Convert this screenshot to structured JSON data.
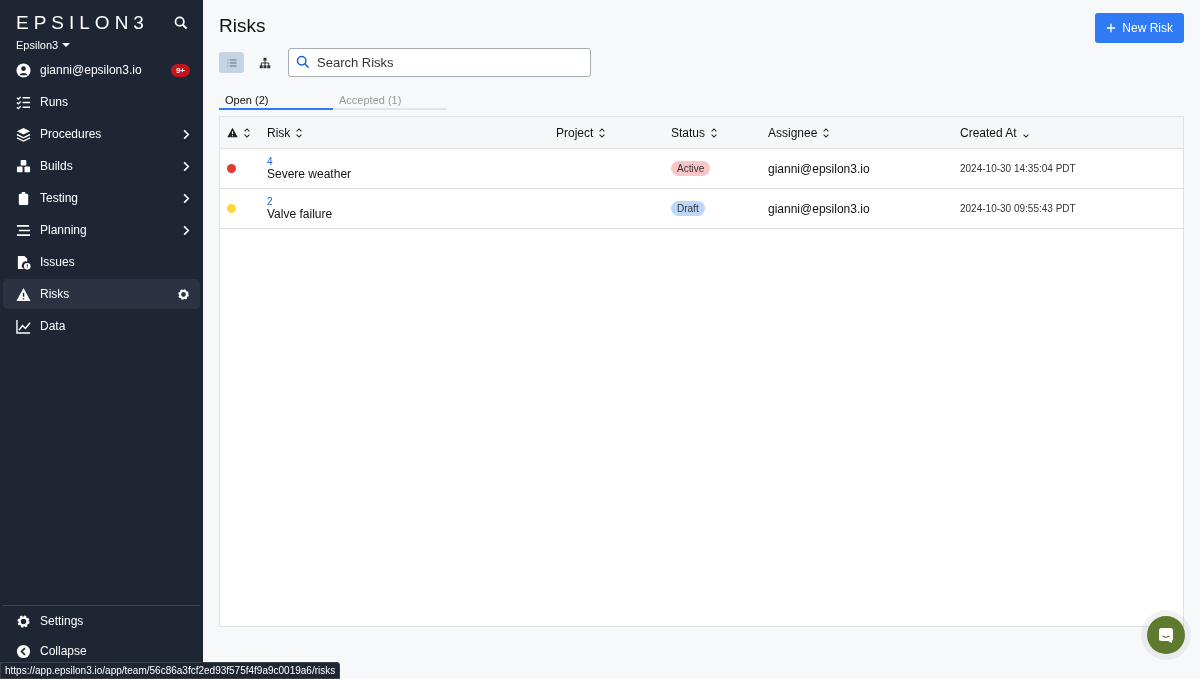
{
  "sidebar": {
    "logo": "EPSILON3",
    "workspace": "Epsilon3",
    "user": {
      "label": "gianni@epsilon3.io",
      "badge": "9+"
    },
    "items": [
      {
        "label": "Runs",
        "kind": "runs",
        "expandable": false,
        "selected": false
      },
      {
        "label": "Procedures",
        "kind": "layers",
        "expandable": true,
        "selected": false
      },
      {
        "label": "Builds",
        "kind": "cubes",
        "expandable": true,
        "selected": false
      },
      {
        "label": "Testing",
        "kind": "clipboard",
        "expandable": true,
        "selected": false
      },
      {
        "label": "Planning",
        "kind": "bars",
        "expandable": true,
        "selected": false
      },
      {
        "label": "Issues",
        "kind": "file",
        "expandable": false,
        "selected": false
      },
      {
        "label": "Risks",
        "kind": "warning",
        "expandable": false,
        "selected": true
      },
      {
        "label": "Data",
        "kind": "chart",
        "expandable": false,
        "selected": false
      }
    ],
    "footer": [
      {
        "label": "Settings",
        "kind": "gear"
      },
      {
        "label": "Collapse",
        "kind": "collapse"
      }
    ]
  },
  "page": {
    "title": "Risks",
    "new_button": "New Risk",
    "views": [
      {
        "kind": "list",
        "selected": true
      },
      {
        "kind": "tree",
        "selected": false
      }
    ],
    "search": {
      "placeholder": "Search Risks"
    },
    "tabs": [
      {
        "label": "Open (2)",
        "selected": true
      },
      {
        "label": "Accepted (1)",
        "selected": false
      }
    ]
  },
  "table": {
    "columns": [
      {
        "kind": "icon",
        "sorted": false
      },
      {
        "kind": "text",
        "label": "Risk",
        "sorted": false
      },
      {
        "kind": "text",
        "label": "Project",
        "sorted": false
      },
      {
        "kind": "text",
        "label": "Status",
        "sorted": false
      },
      {
        "kind": "text",
        "label": "Assignee",
        "sorted": false
      },
      {
        "kind": "text",
        "label": "Created At",
        "sorted": true
      }
    ],
    "rows": [
      {
        "color": "#e53935",
        "id": "4",
        "name": "Severe weather",
        "status": {
          "label": "Active",
          "color": "#f9c6c8"
        },
        "assignee": "gianni@epsilon3.io",
        "created": "2024-10-30 14:35:04 PDT"
      },
      {
        "color": "#fdd835",
        "id": "2",
        "name": "Valve failure",
        "status": {
          "label": "Draft",
          "color": "#bcd7fb"
        },
        "assignee": "gianni@epsilon3.io",
        "created": "2024-10-30 09:55:43 PDT"
      }
    ]
  },
  "status_url": "https://app.epsilon3.io/app/team/56c86a3fcf2ed93f575f4f9a9c0019a6/risks"
}
